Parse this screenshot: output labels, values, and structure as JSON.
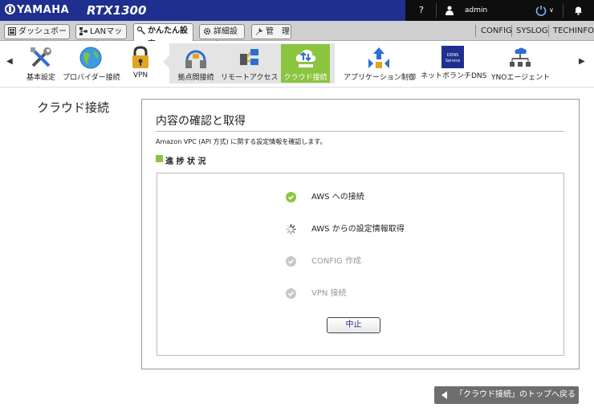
{
  "header": {
    "brand": "YAMAHA",
    "model": "RTX1300",
    "help": "?",
    "user": "admin",
    "user_icon": "person-icon",
    "power_icon": "power-icon",
    "bell_icon": "bell-icon"
  },
  "tabs": [
    {
      "label": "ダッシュボード",
      "icon": "dashboard-icon"
    },
    {
      "label": "LANマップ",
      "icon": "lanmap-icon"
    },
    {
      "label": "かんたん設定",
      "icon": "wand-icon",
      "active": true
    },
    {
      "label": "詳細設定",
      "icon": "gear-icon"
    },
    {
      "label": "管　理",
      "icon": "wrench-icon"
    }
  ],
  "top_links": [
    "CONFIG",
    "SYSLOG",
    "TECHINFO"
  ],
  "iconbar": {
    "prev": "◀",
    "next": "▶",
    "items": [
      {
        "label": "基本設定",
        "icon": "tools-icon"
      },
      {
        "label": "プロバイダー接続",
        "icon": "globe-icon"
      },
      {
        "label": "VPN",
        "icon": "lock-icon"
      },
      {
        "label": "拠点間接続",
        "icon": "site-vpn-icon"
      },
      {
        "label": "リモートアクセス",
        "icon": "remote-access-icon"
      },
      {
        "label": "クラウド接続",
        "icon": "cloud-icon",
        "selected": true
      },
      {
        "label": "アプリケーション制御",
        "icon": "app-control-icon"
      },
      {
        "label": "ネットボランチDNS",
        "icon": "ddns-icon",
        "badge_line1": "DDNS",
        "badge_line2": "Service"
      },
      {
        "label": "YNOエージェント",
        "icon": "yno-agent-icon"
      }
    ]
  },
  "sidebar": {
    "title": "クラウド接続"
  },
  "panel": {
    "title": "内容の確認と取得",
    "description": "Amazon VPC (API 方式) に関する設定情報を確認します。",
    "progress_heading": "進 捗 状 況",
    "steps": [
      {
        "label": "AWS への接続",
        "status": "done"
      },
      {
        "label": "AWS からの設定情報取得",
        "status": "running"
      },
      {
        "label": "CONFIG 作成",
        "status": "pending"
      },
      {
        "label": "VPN 接続",
        "status": "pending"
      }
    ],
    "stop_label": "中止"
  },
  "back_button": "「クラウド接続」のトップへ戻る",
  "colors": {
    "header": "#1f2f8f",
    "accent": "#8bc53f",
    "dark": "#0e0e0e"
  }
}
